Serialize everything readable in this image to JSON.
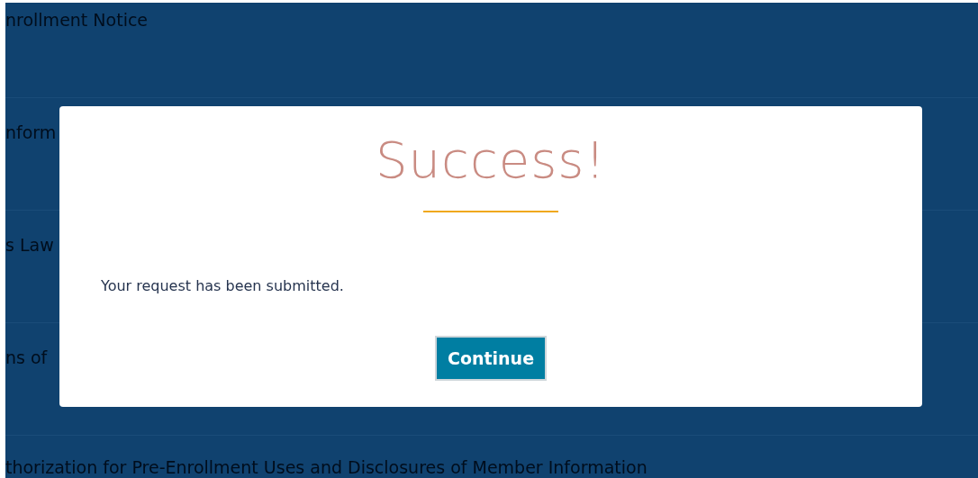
{
  "background_list": [
    {
      "label": "nrollment Notice"
    },
    {
      "label": "nform"
    },
    {
      "label": "s Law"
    },
    {
      "label": "ns of"
    },
    {
      "label": "thorization for Pre-Enrollment Uses and Disclosures of Member Information"
    }
  ],
  "dialog": {
    "title": "Success!",
    "message": "Your request has been submitted.",
    "button": "Continue"
  }
}
